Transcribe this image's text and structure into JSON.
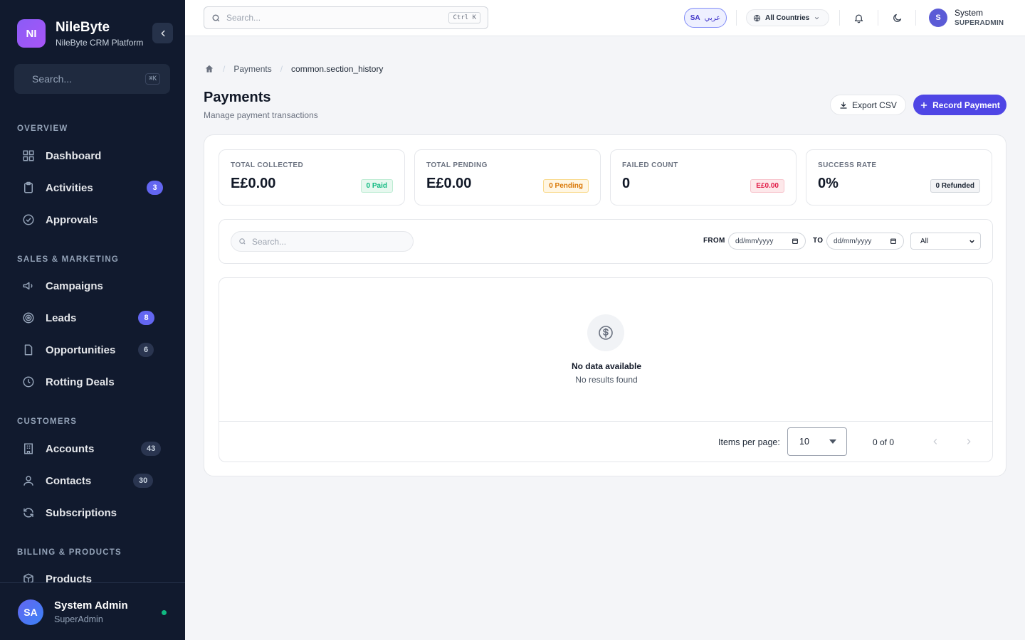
{
  "brand": {
    "logo": "NI",
    "name": "NileByte",
    "subtitle": "NileByte CRM Platform"
  },
  "sidebar": {
    "search_placeholder": "Search...",
    "search_shortcut": "⌘K",
    "sections": [
      {
        "title": "OVERVIEW",
        "items": [
          {
            "label": "Dashboard",
            "icon": "grid-icon"
          },
          {
            "label": "Activities",
            "icon": "clipboard-icon",
            "badge": "3"
          },
          {
            "label": "Approvals",
            "icon": "check-circle-icon"
          }
        ]
      },
      {
        "title": "SALES & MARKETING",
        "items": [
          {
            "label": "Campaigns",
            "icon": "megaphone-icon"
          },
          {
            "label": "Leads",
            "icon": "target-icon",
            "badge": "8"
          },
          {
            "label": "Opportunities",
            "icon": "file-icon",
            "badge": "6"
          },
          {
            "label": "Rotting Deals",
            "icon": "clock-icon"
          }
        ]
      },
      {
        "title": "CUSTOMERS",
        "items": [
          {
            "label": "Accounts",
            "icon": "building-icon",
            "badge": "43"
          },
          {
            "label": "Contacts",
            "icon": "user-icon",
            "badge": "30"
          },
          {
            "label": "Subscriptions",
            "icon": "refresh-icon"
          }
        ]
      },
      {
        "title": "BILLING & PRODUCTS",
        "items": [
          {
            "label": "Products",
            "icon": "box-icon"
          }
        ]
      }
    ],
    "footer": {
      "avatar": "SA",
      "name": "System Admin",
      "role": "SuperAdmin",
      "status_color": "#10b981"
    }
  },
  "topbar": {
    "search_placeholder": "Search...",
    "search_shortcut": "Ctrl K",
    "lang_code": "SA",
    "lang_label": "عربي",
    "country_label": "All Countries",
    "user": {
      "avatar": "S",
      "name": "System",
      "role": "SUPERADMIN"
    }
  },
  "breadcrumb": {
    "items": [
      "Payments",
      "common.section_history"
    ]
  },
  "page": {
    "title": "Payments",
    "subtitle": "Manage payment transactions",
    "export_label": "Export CSV",
    "record_label": "Record Payment"
  },
  "stats": [
    {
      "label": "TOTAL COLLECTED",
      "value": "E£0.00",
      "chip": "0 Paid",
      "tone": "green"
    },
    {
      "label": "TOTAL PENDING",
      "value": "E£0.00",
      "chip": "0 Pending",
      "tone": "amber"
    },
    {
      "label": "FAILED COUNT",
      "value": "0",
      "chip": "E£0.00",
      "tone": "red"
    },
    {
      "label": "SUCCESS RATE",
      "value": "0%",
      "chip": "0 Refunded",
      "tone": "gray"
    }
  ],
  "filters": {
    "search_placeholder": "Search...",
    "from_label": "FROM",
    "to_label": "TO",
    "from_value": "dd/mm/yyyy",
    "to_value": "dd/mm/yyyy",
    "status_value": "All"
  },
  "table": {
    "empty_title": "No data available",
    "empty_subtitle": "No results found",
    "items_per_page_label": "Items per page:",
    "items_per_page": "10",
    "range": "0 of 0"
  },
  "colors": {
    "accent": "#4f46e5",
    "sidebar_bg": "#111a2e",
    "badge": "#6366f1"
  }
}
